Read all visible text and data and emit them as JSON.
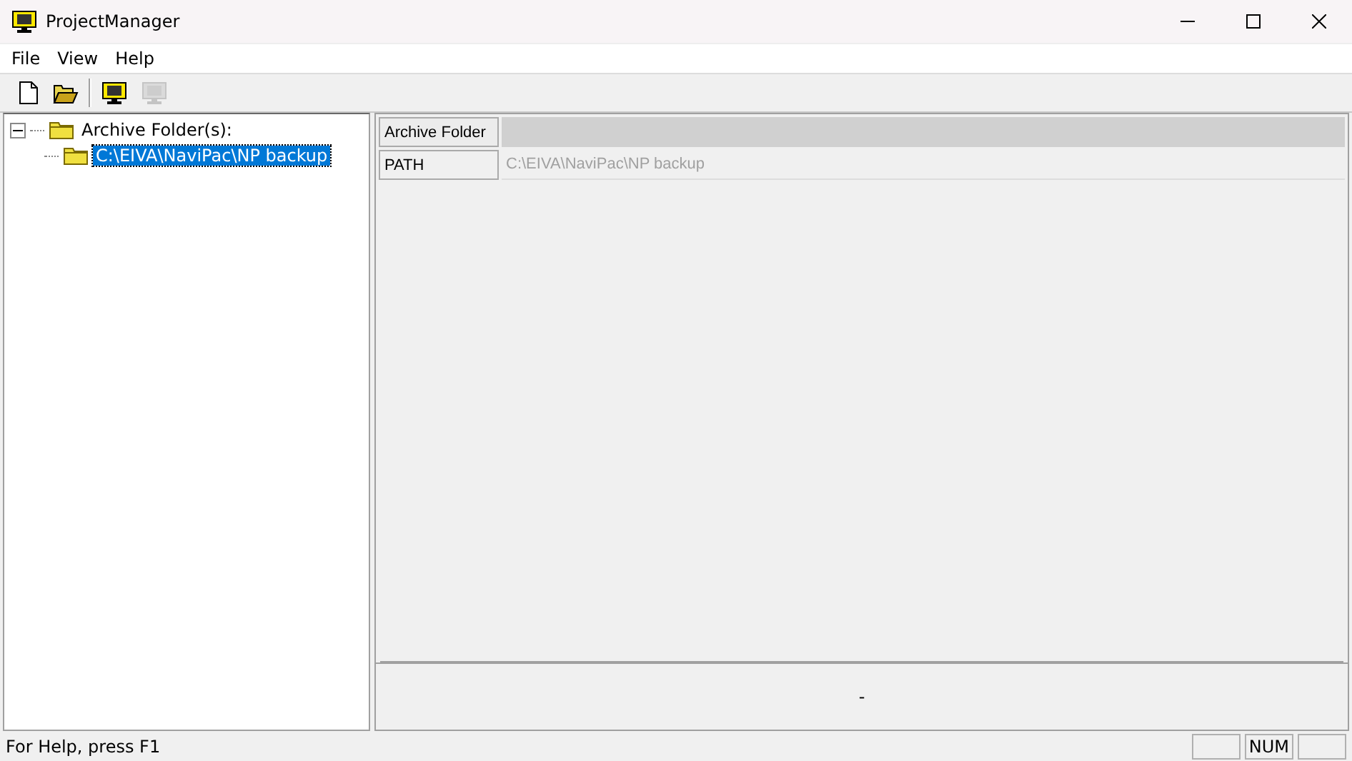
{
  "window": {
    "title": "ProjectManager"
  },
  "menu": [
    {
      "label": "File"
    },
    {
      "label": "View"
    },
    {
      "label": "Help"
    }
  ],
  "toolbar": [
    {
      "kind": "new",
      "disabled": false
    },
    {
      "kind": "open",
      "disabled": false
    },
    {
      "kind": "separator"
    },
    {
      "kind": "monitor",
      "disabled": false
    },
    {
      "kind": "monitor",
      "disabled": true
    }
  ],
  "tree": [
    {
      "label": "Archive Folder(s):",
      "expanded": true,
      "selected": false,
      "children": [
        {
          "label": "C:\\EIVA\\NaviPac\\NP backup",
          "selected": true
        }
      ]
    }
  ],
  "properties": {
    "header": "Archive Folder",
    "rows": [
      {
        "name": "PATH",
        "value": "C:\\EIVA\\NaviPac\\NP backup",
        "readonly": true
      }
    ],
    "description": "-"
  },
  "status_bar": {
    "text": "For Help, press F1",
    "panes": [
      {
        "kind": "blank"
      },
      {
        "kind": "label",
        "text": "NUM"
      },
      {
        "kind": "blank"
      }
    ]
  }
}
